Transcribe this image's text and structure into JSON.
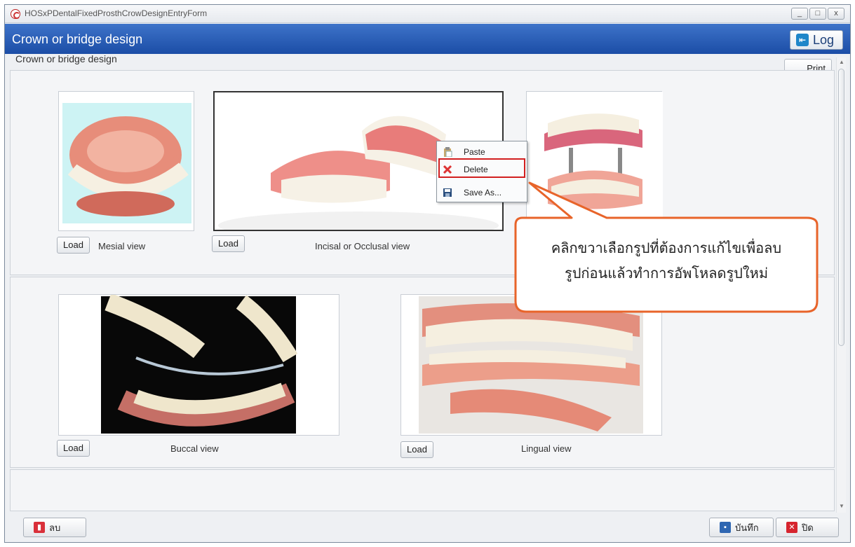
{
  "window": {
    "title": "HOSxPDentalFixedProsthCrowDesignEntryForm",
    "controls": [
      "_",
      "□",
      "x"
    ]
  },
  "header": {
    "title": "Crown or bridge design",
    "log_label": "Log"
  },
  "group": {
    "label": "Crown or bridge design",
    "print_label": "Print"
  },
  "views": {
    "mesial": {
      "load": "Load",
      "caption": "Mesial view"
    },
    "incisal": {
      "load": "Load",
      "caption": "Incisal or Occlusal view"
    },
    "buccal": {
      "load": "Load",
      "caption": "Buccal view"
    },
    "lingual": {
      "load": "Load",
      "caption": "Lingual view"
    }
  },
  "context_menu": {
    "items": [
      "Paste",
      "Delete",
      "Save As..."
    ]
  },
  "callout": {
    "line1": "คลิกขวาเลือกรูปที่ต้องการแก้ไขเพื่อลบ",
    "line2": "รูปก่อนแล้วทำการอัพโหลดรูปใหม่"
  },
  "footer": {
    "delete_label": "ลบ",
    "save_label": "บันทึก",
    "close_label": "ปิด"
  },
  "colors": {
    "header_blue": "#2357b3",
    "callout_border": "#e8642a",
    "highlight_red": "#d21f1f",
    "gum_pink": "#e88a86",
    "teeth_white": "#f6f1e6"
  }
}
